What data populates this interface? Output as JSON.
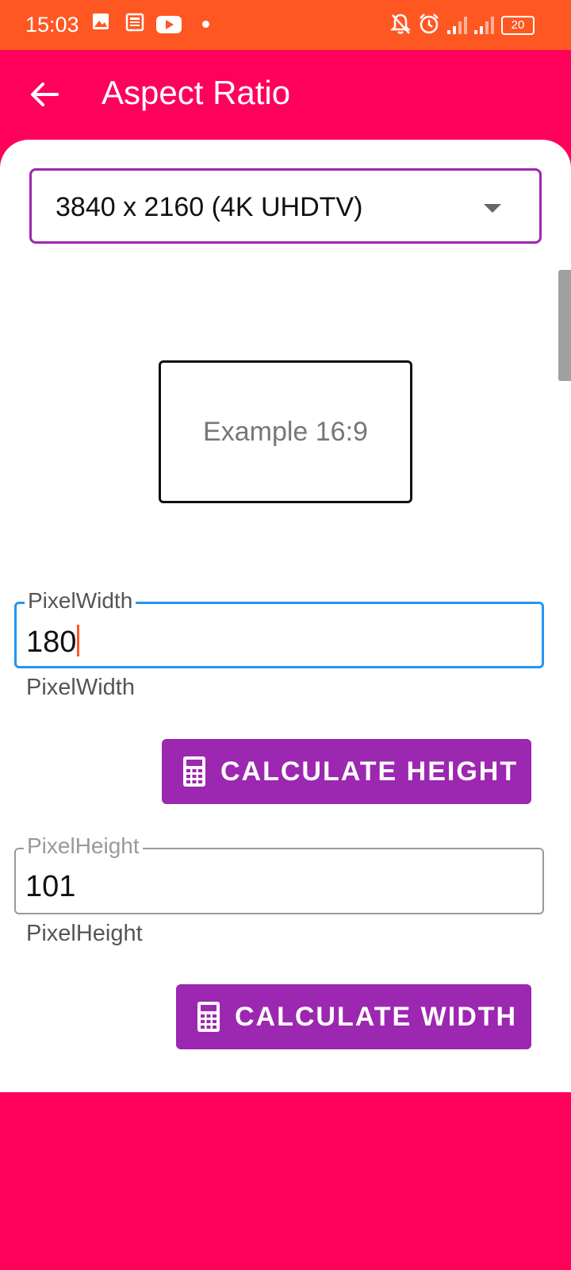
{
  "status_bar": {
    "time": "15:03",
    "battery": "20",
    "icons": [
      "image-icon",
      "news-icon",
      "youtube-icon",
      "dot-icon",
      "mute-bell-icon",
      "alarm-icon",
      "signal-icon",
      "signal-icon",
      "battery-icon"
    ]
  },
  "app_bar": {
    "title": "Aspect Ratio",
    "back_icon": "arrow-left-icon"
  },
  "resolution_select": {
    "value": "3840 x 2160 (4K UHDTV)"
  },
  "example": {
    "label": "Example 16:9"
  },
  "width_field": {
    "label": "PixelWidth",
    "value": "180",
    "helper": "PixelWidth"
  },
  "calc_height_button": {
    "label": "CALCULATE HEIGHT",
    "icon": "calculator-icon"
  },
  "height_field": {
    "label": "PixelHeight",
    "value": "101",
    "helper": "PixelHeight"
  },
  "calc_width_button": {
    "label": "CALCULATE WIDTH",
    "icon": "calculator-icon"
  },
  "colors": {
    "status_bar": "#FF5722",
    "app_bar": "#FF005A",
    "accent": "#9C27B0",
    "focus": "#2196F3"
  }
}
